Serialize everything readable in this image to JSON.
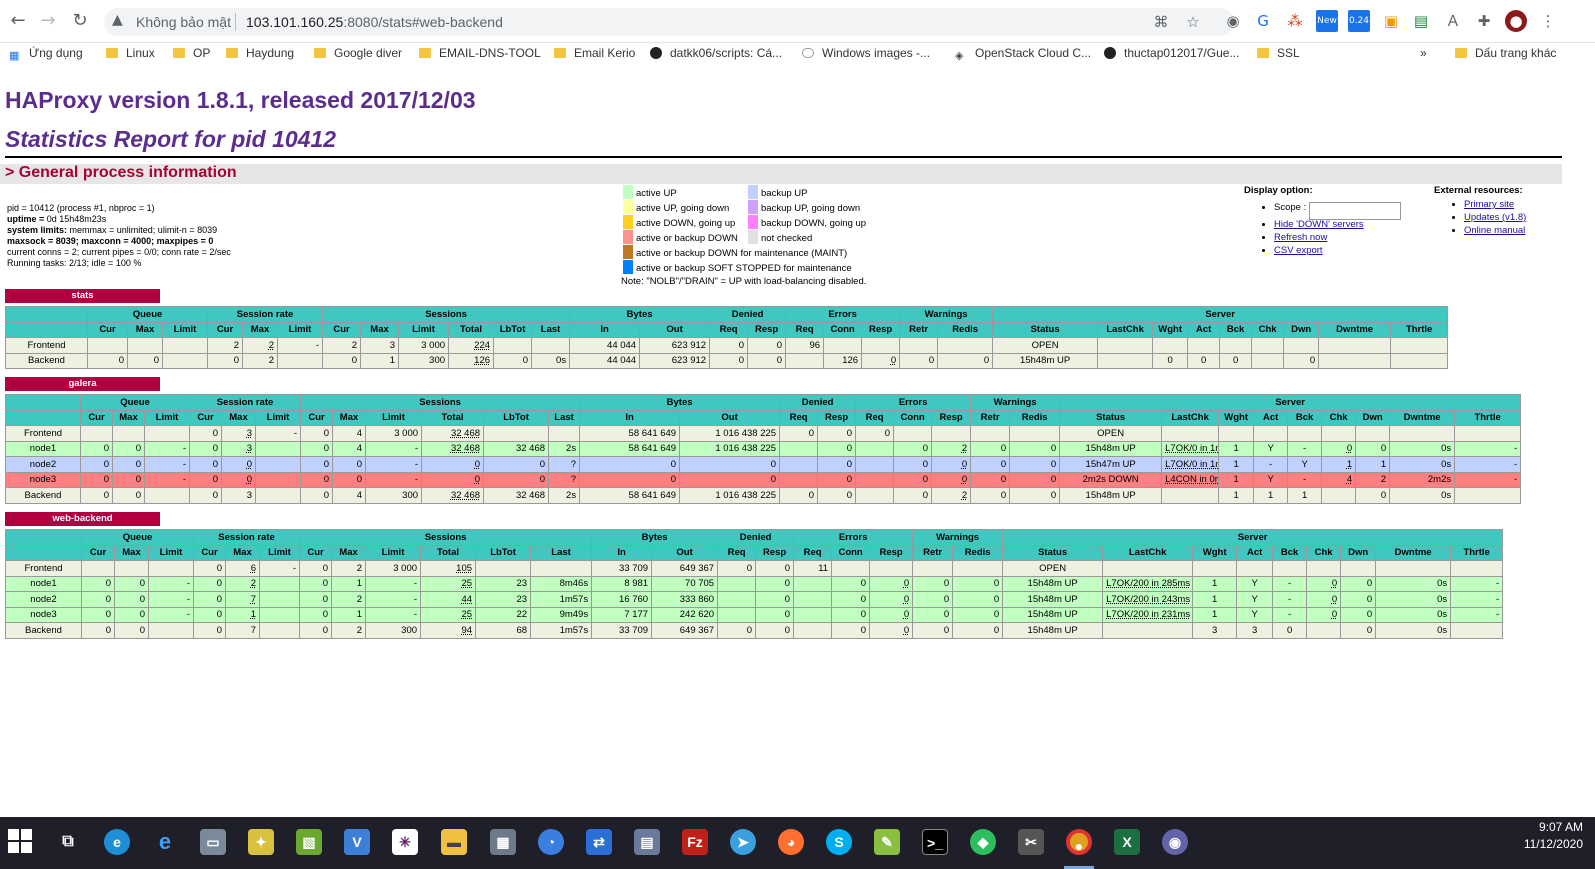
{
  "browser": {
    "security": "Không bảo mật",
    "url_host": "103.101.160.25",
    "url_rest": ":8080/stats#web-backend",
    "bookmarks": [
      {
        "label": "Ứng dụng",
        "icon": "apps-grid-icon"
      },
      {
        "label": "Linux",
        "icon": "folder-icon"
      },
      {
        "label": "OP",
        "icon": "folder-icon"
      },
      {
        "label": "Haydung",
        "icon": "folder-icon"
      },
      {
        "label": "Google diver",
        "icon": "folder-icon"
      },
      {
        "label": "EMAIL-DNS-TOOL",
        "icon": "folder-icon"
      },
      {
        "label": "Email Kerio",
        "icon": "folder-icon"
      },
      {
        "label": "datkk06/scripts: Cá...",
        "icon": "github-icon"
      },
      {
        "label": "Windows images -...",
        "icon": "cloud-icon"
      },
      {
        "label": "OpenStack Cloud C...",
        "icon": "openstack-icon"
      },
      {
        "label": "thuctap012017/Gue...",
        "icon": "github-icon"
      },
      {
        "label": "SSL",
        "icon": "folder-icon"
      },
      {
        "label": "»",
        "icon": ""
      },
      {
        "label": "Dấu trang khác",
        "icon": "folder-icon"
      }
    ]
  },
  "page": {
    "title": "HAProxy version 1.8.1, released 2017/12/03",
    "subtitle": "Statistics Report for pid 10412",
    "section": "> General process information",
    "procinfo": {
      "l1": "pid = 10412 (process #1, nbproc = 1)",
      "l2a": "uptime = ",
      "l2b": "0d 15h48m23s",
      "l3a": "system limits:",
      "l3b": " memmax = unlimited; ulimit-n = 8039",
      "l4": "maxsock = 8039; maxconn = 4000; maxpipes = 0",
      "l5": "current conns = 2; current pipes = 0/0; conn rate = 2/sec",
      "l6": "Running tasks: 2/13; idle = 100 %"
    },
    "legend": [
      {
        "label": "active UP",
        "color": "#c0ffc0"
      },
      {
        "label": "active UP, going down",
        "color": "#ffffa0"
      },
      {
        "label": "active DOWN, going up",
        "color": "#ffd020"
      },
      {
        "label": "active or backup DOWN",
        "color": "#ff9090"
      },
      {
        "label": "active or backup DOWN for maintenance (MAINT)",
        "color": "#c07820"
      },
      {
        "label": "active or backup SOFT STOPPED for maintenance",
        "color": "#0080ff"
      },
      {
        "label": "backup UP",
        "color": "#c0d0ff"
      },
      {
        "label": "backup UP, going down",
        "color": "#d0a0ff"
      },
      {
        "label": "backup DOWN, going up",
        "color": "#ff80ff"
      },
      {
        "label": "not checked",
        "color": "#e0e0e0"
      }
    ],
    "legend_note": "Note: \"NOLB\"/\"DRAIN\" = UP with load-balancing disabled.",
    "display": {
      "title": "Display option:",
      "scope": "Scope :",
      "hide": "Hide 'DOWN' servers",
      "refresh": "Refresh now",
      "csv": "CSV export"
    },
    "external": {
      "title": "External resources:",
      "primary": "Primary site",
      "updates": "Updates (v1.8)",
      "manual": "Online manual"
    }
  },
  "headers": {
    "groups": [
      "Queue",
      "Session rate",
      "Sessions",
      "Bytes",
      "Denied",
      "Errors",
      "Warnings",
      "Server"
    ],
    "cols": [
      "Cur",
      "Max",
      "Limit",
      "Cur",
      "Max",
      "Limit",
      "Cur",
      "Max",
      "Limit",
      "Total",
      "LbTot",
      "Last",
      "In",
      "Out",
      "Req",
      "Resp",
      "Req",
      "Conn",
      "Resp",
      "Retr",
      "Redis",
      "Status",
      "LastChk",
      "Wght",
      "Act",
      "Bck",
      "Chk",
      "Dwn",
      "Dwntme",
      "Thrtle"
    ]
  },
  "proxies": [
    {
      "name": "stats",
      "rows": [
        {
          "cls": "front",
          "cells": [
            "Frontend",
            "",
            "",
            "",
            "2",
            "2",
            "-",
            "2",
            "3",
            "3 000",
            "224",
            "",
            "",
            "44 044",
            "623 912",
            "0",
            "0",
            "96",
            "",
            "",
            "",
            "",
            "OPEN",
            "",
            "",
            "",
            "",
            "",
            "",
            "",
            ""
          ]
        },
        {
          "cls": "backend",
          "cells": [
            "Backend",
            "0",
            "0",
            "",
            "0",
            "2",
            "",
            "0",
            "1",
            "300",
            "126",
            "0",
            "0s",
            "44 044",
            "623 912",
            "0",
            "0",
            "",
            "126",
            "0",
            "0",
            "0",
            "15h48m UP",
            "",
            "0",
            "0",
            "0",
            "",
            "0",
            "",
            ""
          ]
        }
      ]
    },
    {
      "name": "galera",
      "rows": [
        {
          "cls": "front",
          "cells": [
            "Frontend",
            "",
            "",
            "",
            "0",
            "3",
            "-",
            "0",
            "4",
            "3 000",
            "32 468",
            "",
            "",
            "58 641 649",
            "1 016 438 225",
            "0",
            "0",
            "0",
            "",
            "",
            "",
            "",
            "OPEN",
            "",
            "",
            "",
            "",
            "",
            "",
            "",
            ""
          ]
        },
        {
          "cls": "up",
          "cells": [
            "node1",
            "0",
            "0",
            "-",
            "0",
            "3",
            "",
            "0",
            "4",
            "-",
            "32 468",
            "32 468",
            "2s",
            "58 641 649",
            "1 016 438 225",
            "",
            "0",
            "",
            "0",
            "2",
            "0",
            "0",
            "15h48m UP",
            "L7OK/0 in 1ms",
            "1",
            "Y",
            "-",
            "0",
            "0",
            "0s",
            "-"
          ]
        },
        {
          "cls": "bk",
          "cells": [
            "node2",
            "0",
            "0",
            "-",
            "0",
            "0",
            "",
            "0",
            "0",
            "-",
            "0",
            "0",
            "?",
            "0",
            "0",
            "",
            "0",
            "",
            "0",
            "0",
            "0",
            "0",
            "15h47m UP",
            "L7OK/0 in 1ms",
            "1",
            "-",
            "Y",
            "1",
            "1",
            "0s",
            "-"
          ]
        },
        {
          "cls": "down",
          "cells": [
            "node3",
            "0",
            "0",
            "-",
            "0",
            "0",
            "",
            "0",
            "0",
            "-",
            "0",
            "0",
            "?",
            "0",
            "0",
            "",
            "0",
            "",
            "0",
            "0",
            "0",
            "0",
            "2m2s DOWN",
            "L4CON in 0ms",
            "1",
            "Y",
            "-",
            "4",
            "2",
            "2m2s",
            "-"
          ]
        },
        {
          "cls": "backend",
          "cells": [
            "Backend",
            "0",
            "0",
            "",
            "0",
            "3",
            "",
            "0",
            "4",
            "300",
            "32 468",
            "32 468",
            "2s",
            "58 641 649",
            "1 016 438 225",
            "0",
            "0",
            "",
            "0",
            "2",
            "0",
            "0",
            "15h48m UP",
            "",
            "1",
            "1",
            "1",
            "",
            "0",
            "0s",
            ""
          ]
        }
      ]
    },
    {
      "name": "web-backend",
      "rows": [
        {
          "cls": "front",
          "cells": [
            "Frontend",
            "",
            "",
            "",
            "0",
            "6",
            "-",
            "0",
            "2",
            "3 000",
            "105",
            "",
            "",
            "33 709",
            "649 367",
            "0",
            "0",
            "11",
            "",
            "",
            "",
            "",
            "OPEN",
            "",
            "",
            "",
            "",
            "",
            "",
            "",
            ""
          ]
        },
        {
          "cls": "up",
          "cells": [
            "node1",
            "0",
            "0",
            "-",
            "0",
            "2",
            "",
            "0",
            "1",
            "-",
            "25",
            "23",
            "8m46s",
            "8 981",
            "70 705",
            "",
            "0",
            "",
            "0",
            "0",
            "0",
            "0",
            "15h48m UP",
            "L7OK/200 in 285ms",
            "1",
            "Y",
            "-",
            "0",
            "0",
            "0s",
            "-"
          ]
        },
        {
          "cls": "up",
          "cells": [
            "node2",
            "0",
            "0",
            "-",
            "0",
            "7",
            "",
            "0",
            "2",
            "-",
            "44",
            "23",
            "1m57s",
            "16 760",
            "333 860",
            "",
            "0",
            "",
            "0",
            "0",
            "0",
            "0",
            "15h48m UP",
            "L7OK/200 in 243ms",
            "1",
            "Y",
            "-",
            "0",
            "0",
            "0s",
            "-"
          ]
        },
        {
          "cls": "up",
          "cells": [
            "node3",
            "0",
            "0",
            "-",
            "0",
            "1",
            "",
            "0",
            "1",
            "-",
            "25",
            "22",
            "9m49s",
            "7 177",
            "242 620",
            "",
            "0",
            "",
            "0",
            "0",
            "0",
            "0",
            "15h48m UP",
            "L7OK/200 in 231ms",
            "1",
            "Y",
            "-",
            "0",
            "0",
            "0s",
            "-"
          ]
        },
        {
          "cls": "backend",
          "cells": [
            "Backend",
            "0",
            "0",
            "",
            "0",
            "7",
            "",
            "0",
            "2",
            "300",
            "94",
            "68",
            "1m57s",
            "33 709",
            "649 367",
            "0",
            "0",
            "",
            "0",
            "0",
            "0",
            "0",
            "15h48m UP",
            "",
            "3",
            "3",
            "0",
            "",
            "0",
            "0s",
            ""
          ]
        }
      ]
    }
  ],
  "taskbar": {
    "time": "9:07 AM",
    "date": "11/12/2020"
  }
}
